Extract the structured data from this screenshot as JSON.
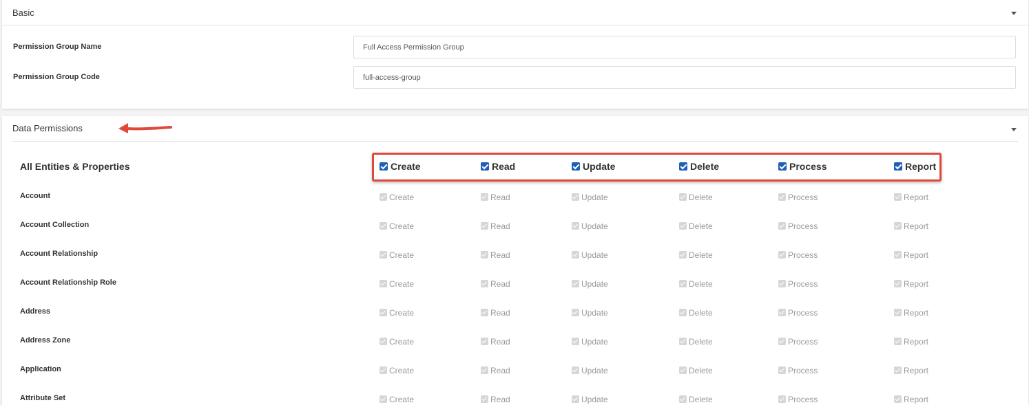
{
  "basic": {
    "title": "Basic",
    "fields": [
      {
        "label": "Permission Group Name",
        "value": "Full Access Permission Group"
      },
      {
        "label": "Permission Group Code",
        "value": "full-access-group"
      }
    ]
  },
  "data_permissions": {
    "title": "Data Permissions",
    "all_label": "All Entities & Properties",
    "header": [
      "Create",
      "Read",
      "Update",
      "Delete",
      "Process",
      "Report"
    ],
    "perms": [
      "Create",
      "Read",
      "Update",
      "Delete",
      "Process",
      "Report"
    ],
    "rows": [
      "Account",
      "Account Collection",
      "Account Relationship",
      "Account Relationship Role",
      "Address",
      "Address Zone",
      "Application",
      "Attribute Set"
    ]
  },
  "annotation": {
    "highlight_color": "#e0483b",
    "arrow_color": "#e0483b"
  },
  "colors": {
    "checkbox_checked": "#1f5fb8",
    "checkbox_disabled": "#d6d6d6"
  },
  "icons": {
    "panel_toggle": "caret-down-icon",
    "checkbox": "checkbox-checked-icon",
    "annotation": "arrow-left-icon"
  }
}
